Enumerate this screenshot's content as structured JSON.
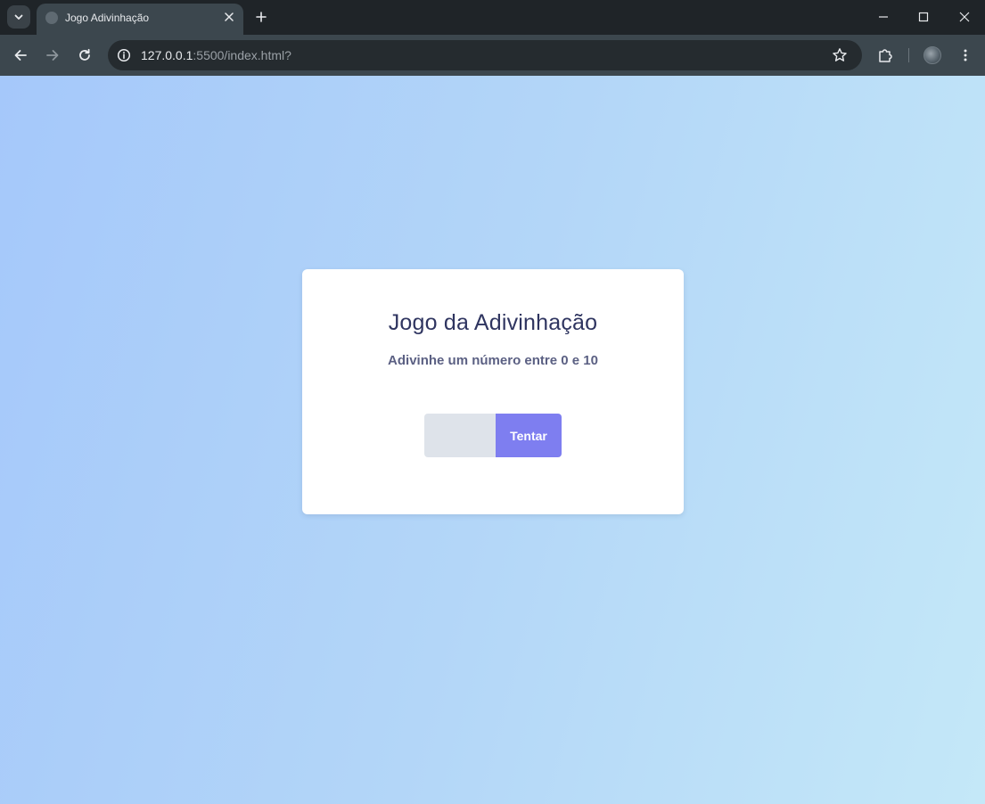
{
  "browser": {
    "tab": {
      "title": "Jogo Adivinhação"
    },
    "address_bar": {
      "url_host": "127.0.0.1",
      "url_path": ":5500/index.html?"
    }
  },
  "page": {
    "title": "Jogo da Adivinhação",
    "subtitle": "Adivinhe um número entre 0 e 10",
    "guess_input": {
      "value": "",
      "placeholder": ""
    },
    "submit_label": "Tentar"
  },
  "colors": {
    "accent_button": "#7e7ef0",
    "title_text": "#2f3560",
    "subtitle_text": "#5b6083",
    "input_background": "#dee3ea",
    "background_gradient_start": "#a5c8fa",
    "background_gradient_end": "#c4e8f8"
  },
  "icons": {
    "tab_search": "chevron-down-icon",
    "tab_favicon": "globe-icon",
    "tab_close": "close-icon",
    "new_tab": "plus-icon",
    "minimize": "minimize-icon",
    "maximize": "maximize-icon",
    "close_window": "close-icon",
    "back": "arrow-left-icon",
    "forward": "arrow-right-icon",
    "reload": "reload-icon",
    "site_info": "info-icon",
    "bookmark": "star-icon",
    "extensions": "puzzle-icon",
    "menu": "more-vertical-icon"
  }
}
